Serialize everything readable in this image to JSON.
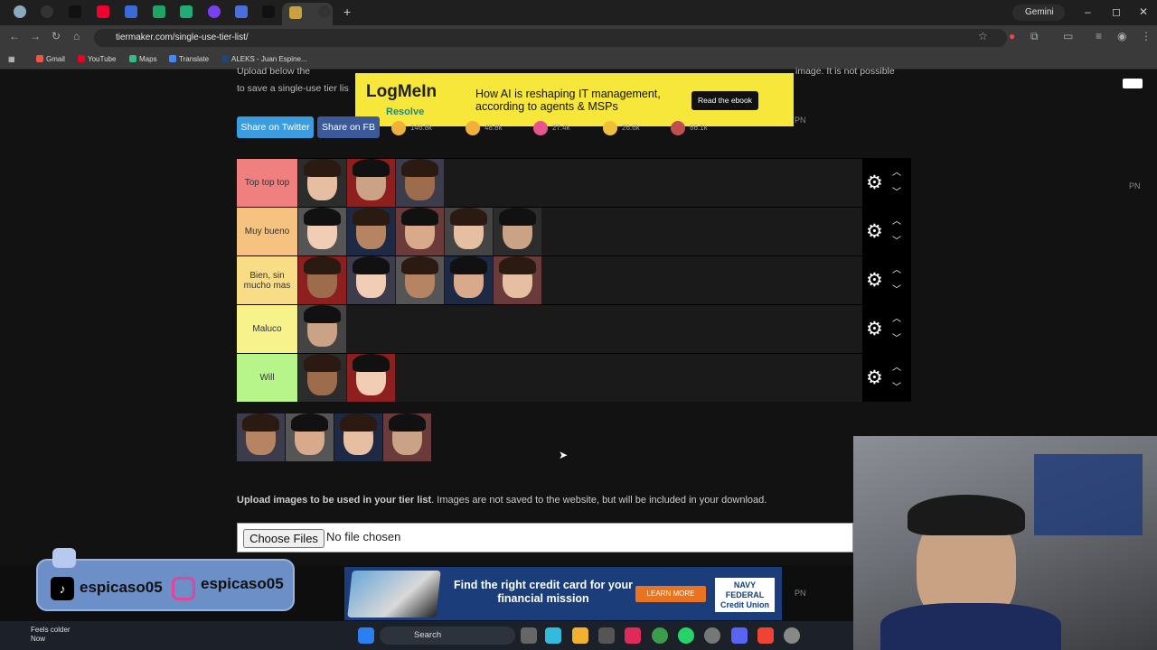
{
  "browser": {
    "gemini_label": "Gemini",
    "url": "tiermaker.com/single-use-tier-list/",
    "bookmarks": [
      "Gmail",
      "YouTube",
      "Maps",
      "Translate",
      "ALEKS - Juan Espine..."
    ],
    "win_min": "–",
    "win_max": "◻",
    "win_close": "✕",
    "new_tab": "+"
  },
  "page": {
    "intro_line1": "Upload below the",
    "intro_line1_right": "image. It is not possible",
    "intro_line2": "to save a single-use tier lis",
    "share_twitter": "Share on Twitter",
    "share_fb": "Share on FB",
    "reactions": [
      "146.8k",
      "48.8k",
      "27.4k",
      "26.6k",
      "66.1k"
    ],
    "pn_label": "PN"
  },
  "ad_top": {
    "logo": "LogMeIn",
    "sub": "Resolve",
    "message": "How AI is reshaping IT management, according to agents & MSPs",
    "cta": "Read the ebook"
  },
  "tiers": [
    {
      "label": "Top top top",
      "color": "#f08080",
      "count": 3
    },
    {
      "label": "Muy bueno",
      "color": "#f6c27f",
      "count": 5
    },
    {
      "label": "Bien, sin mucho mas",
      "color": "#f8dd86",
      "count": 5
    },
    {
      "label": "Maluco",
      "color": "#f7f28a",
      "count": 1
    },
    {
      "label": "Will",
      "color": "#b7f58a",
      "count": 2
    }
  ],
  "controls": {
    "gear": "⚙",
    "up": "︿",
    "down": "﹀"
  },
  "upload": {
    "bold": "Upload images to be used in your tier list",
    "rest": ". Images are not saved to the website, but will be included in your download.",
    "choose": "Choose Files",
    "nofile": "No file chosen"
  },
  "ad_bottom": {
    "message": "Find the right credit card for your financial mission",
    "cta": "LEARN MORE",
    "brand": "NAVY FEDERAL Credit Union"
  },
  "social": {
    "tiktok": "espicaso05",
    "instagram": "espicaso05"
  },
  "taskbar": {
    "weather_title": "Feels colder",
    "weather_sub": "Now",
    "search": "Search"
  }
}
